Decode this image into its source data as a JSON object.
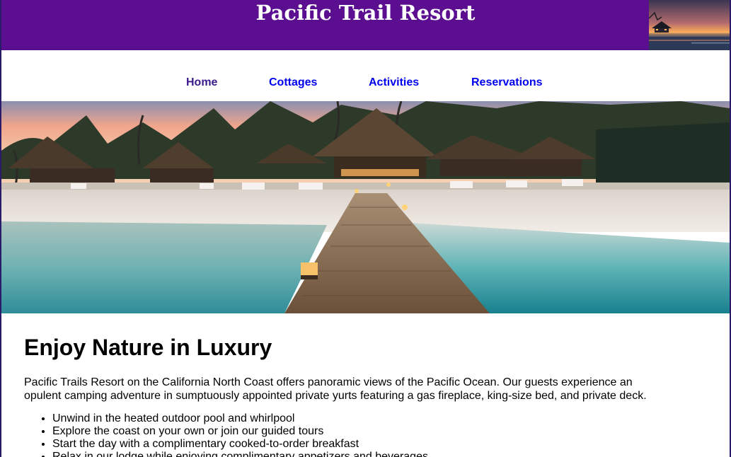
{
  "header": {
    "title": "Pacific Trail Resort"
  },
  "nav": {
    "items": [
      {
        "label": "Home",
        "state": "visited"
      },
      {
        "label": "Cottages",
        "state": "link"
      },
      {
        "label": "Activities",
        "state": "link"
      },
      {
        "label": "Reservations",
        "state": "link"
      }
    ]
  },
  "colors": {
    "header_bg": "#5b0e8f",
    "link": "#0000ee",
    "visited_link": "#3b1a8c"
  },
  "main": {
    "heading": "Enjoy Nature in Luxury",
    "intro": "Pacific Trails Resort on the California North Coast offers panoramic views of the Pacific Ocean. Our guests experience an opulent camping adventure in sumptuously appointed private yurts featuring a gas fireplace, king-size bed, and private deck.",
    "features": [
      "Unwind in the heated outdoor pool and whirlpool",
      "Explore the coast on your own or join our guided tours",
      "Start the day with a complimentary cooked-to-order breakfast",
      "Relax in our lodge while enjoying complimentary appetizers and beverages"
    ]
  }
}
